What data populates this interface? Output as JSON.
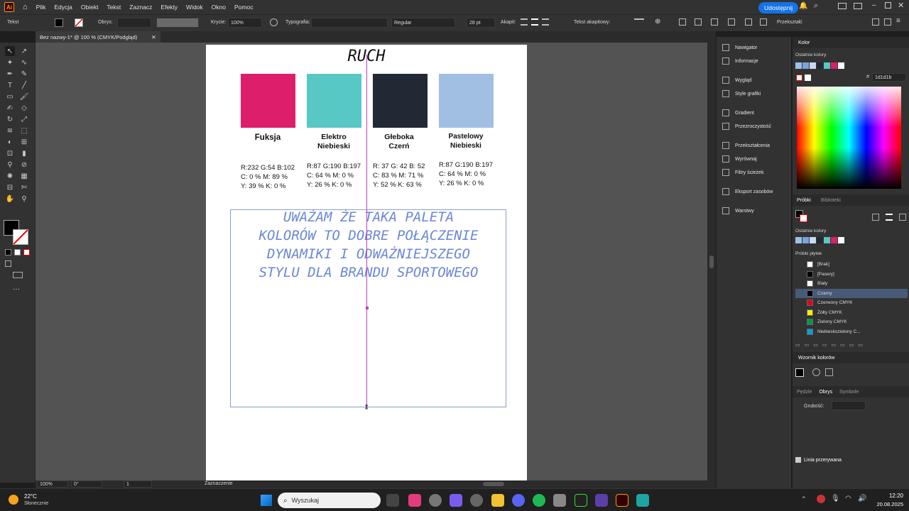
{
  "menubar": {
    "app_logo": "Ai",
    "items": [
      "Plik",
      "Edycja",
      "Obiekt",
      "Tekst",
      "Zaznacz",
      "Efekty",
      "Widok",
      "Okno",
      "Pomoc"
    ],
    "share_label": "Udostępnij"
  },
  "controlbar": {
    "tool_label": "Tekst",
    "stroke_label": "Obrys:",
    "opacity_label": "Krycie:",
    "opacity_value": "100%",
    "typography_label": "Typografia:",
    "font_style": "Regular",
    "font_size": "28 pt",
    "paragraph_label": "Akapit:",
    "threaded_label": "Tekst akapitowy:",
    "transform_label": "Przekształć"
  },
  "document_tab": "Bez nazwy-1* @ 100 % (CMYK/Podgląd)",
  "artboard": {
    "title": "RUCH",
    "swatches": [
      {
        "name_line1": "Fuksja",
        "name_line2": "",
        "color": "#dd1e6b",
        "v1": "R:232 G:54 B:102",
        "v2": "C: 0 % M: 89 %",
        "v3": "Y: 39 % K: 0 %"
      },
      {
        "name_line1": "Elektro",
        "name_line2": "Niebieski",
        "color": "#57c8c4",
        "v1": "R:87 G:190 B:197",
        "v2": "C: 64 % M: 0 %",
        "v3": "Y: 26 % K: 0 %"
      },
      {
        "name_line1": "Głeboka",
        "name_line2": "Czerń",
        "color": "#232835",
        "v1": "R: 37 G: 42 B: 52",
        "v2": "C: 83 % M: 71 %",
        "v3": "Y: 52 % K: 63 %"
      },
      {
        "name_line1": "Pastelowy",
        "name_line2": "Niebieski",
        "color": "#a0bfe3",
        "v1": "R:87 G:190 B:197",
        "v2": "C: 64 % M: 0 %",
        "v3": "Y: 26 % K: 0 %"
      }
    ],
    "headline_lines": [
      "UWAŻAM ŻE TAKA PALETA",
      "KOLORÓW TO DOBRE POŁĄCZENIE",
      "DYNAMIKI I ODWAŻNIEJSZEGO",
      "STYLU DLA BRANDU SPORTOWEGO"
    ]
  },
  "statusbar": {
    "zoom": "100%",
    "rotation": "0°",
    "artboard_num": "1",
    "mode": "Zaznaczenie"
  },
  "panels_left": [
    "Nawigator",
    "Informacje",
    "Wygląd",
    "Style grafiki",
    "Gradient",
    "Przezroczystość",
    "Przekształcenia",
    "Wyrównaj",
    "Filtry ścieżek",
    "Eksport zasobów",
    "Warstwy"
  ],
  "color_panel": {
    "title": "Kolor",
    "recent_label": "Ostatnie kolory",
    "hex_value": "1d1d1b",
    "hex_prefix": "#"
  },
  "swatches_panel": {
    "tab1": "Próbki",
    "tab2": "Biblioteki",
    "recent_label": "Ostatnie kolory",
    "section_label": "Próbki płytek",
    "rows": [
      {
        "label": "[Brak]",
        "color": "#ffffff"
      },
      {
        "label": "[Pasery]",
        "color": "#000000"
      },
      {
        "label": "Biały",
        "color": "#ffffff"
      },
      {
        "label": "Czarny",
        "color": "#000000"
      },
      {
        "label": "Czerwony CMYK",
        "color": "#e3001b"
      },
      {
        "label": "Żółty CMYK",
        "color": "#ffed00"
      },
      {
        "label": "Zielony CMYK",
        "color": "#009a3e"
      },
      {
        "label": "Niebieskozielony C...",
        "color": "#00a0dc"
      }
    ]
  },
  "brush_panel": {
    "title": "Wzornik kolorów"
  },
  "stroke_panel": {
    "tab1": "Pędzle",
    "tab2": "Obrys",
    "tab3": "Symbole",
    "weight_label": "Grubość:",
    "dash_label": "Linia przerywana"
  },
  "taskbar": {
    "weather_temp": "22°C",
    "weather_desc": "Słonecznie",
    "search_placeholder": "Wyszukaj",
    "time": "12:20",
    "date": "20.08.2025"
  },
  "colors": {
    "accent": "#1473e6",
    "guide": "#c040c0"
  }
}
